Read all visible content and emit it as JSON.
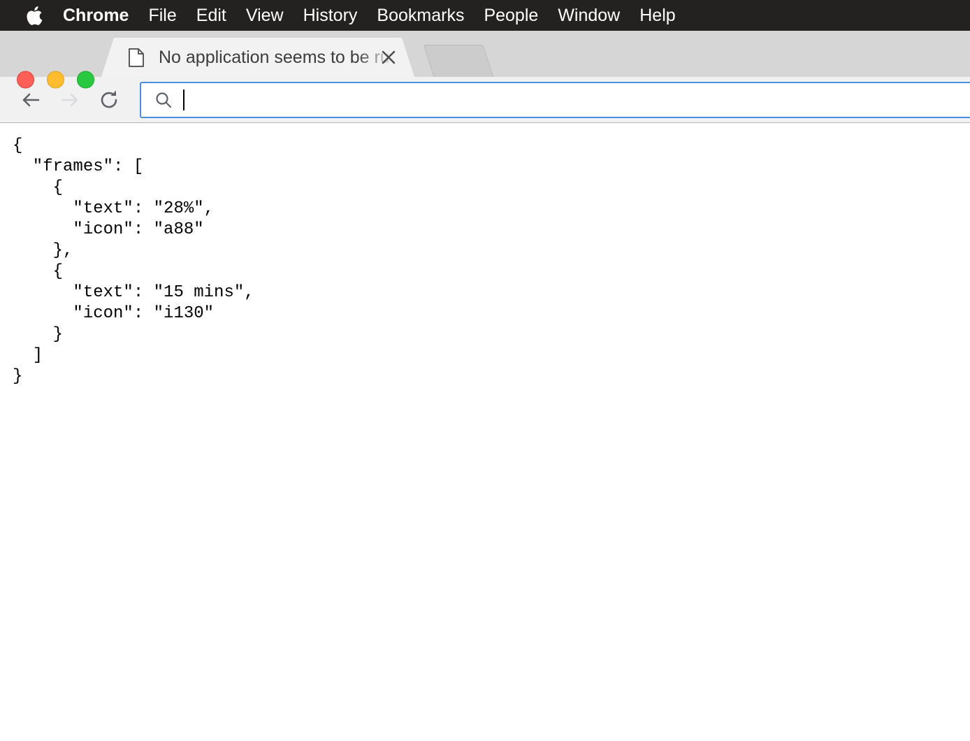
{
  "menubar": {
    "apple_icon": "apple-logo-icon",
    "items": [
      {
        "label": "Chrome",
        "bold": true
      },
      {
        "label": "File",
        "bold": false
      },
      {
        "label": "Edit",
        "bold": false
      },
      {
        "label": "View",
        "bold": false
      },
      {
        "label": "History",
        "bold": false
      },
      {
        "label": "Bookmarks",
        "bold": false
      },
      {
        "label": "People",
        "bold": false
      },
      {
        "label": "Window",
        "bold": false
      },
      {
        "label": "Help",
        "bold": false
      }
    ]
  },
  "window_controls": {
    "close_color": "#ff5f57",
    "minimize_color": "#febc2e",
    "zoom_color": "#28c840"
  },
  "tabstrip": {
    "active_tab": {
      "title": "No application seems to be running",
      "visible_title": "No application seems to be run",
      "favicon": "page-document-icon",
      "close_icon": "close-icon"
    },
    "background_tab": {
      "title": ""
    }
  },
  "toolbar": {
    "back_icon": "arrow-left-icon",
    "forward_icon": "arrow-right-icon",
    "reload_icon": "reload-icon",
    "back_enabled": true,
    "forward_enabled": false,
    "omnibox": {
      "search_icon": "search-icon",
      "value": "",
      "placeholder": "",
      "focused": true,
      "focus_color": "#4a90e2"
    }
  },
  "page": {
    "content_type": "json",
    "raw_text": "{\n  \"frames\": [\n    {\n      \"text\": \"28%\",\n      \"icon\": \"a88\"\n    },\n    {\n      \"text\": \"15 mins\",\n      \"icon\": \"i130\"\n    }\n  ]\n}",
    "parsed": {
      "frames": [
        {
          "text": "28%",
          "icon": "a88"
        },
        {
          "text": "15 mins",
          "icon": "i130"
        }
      ]
    }
  }
}
